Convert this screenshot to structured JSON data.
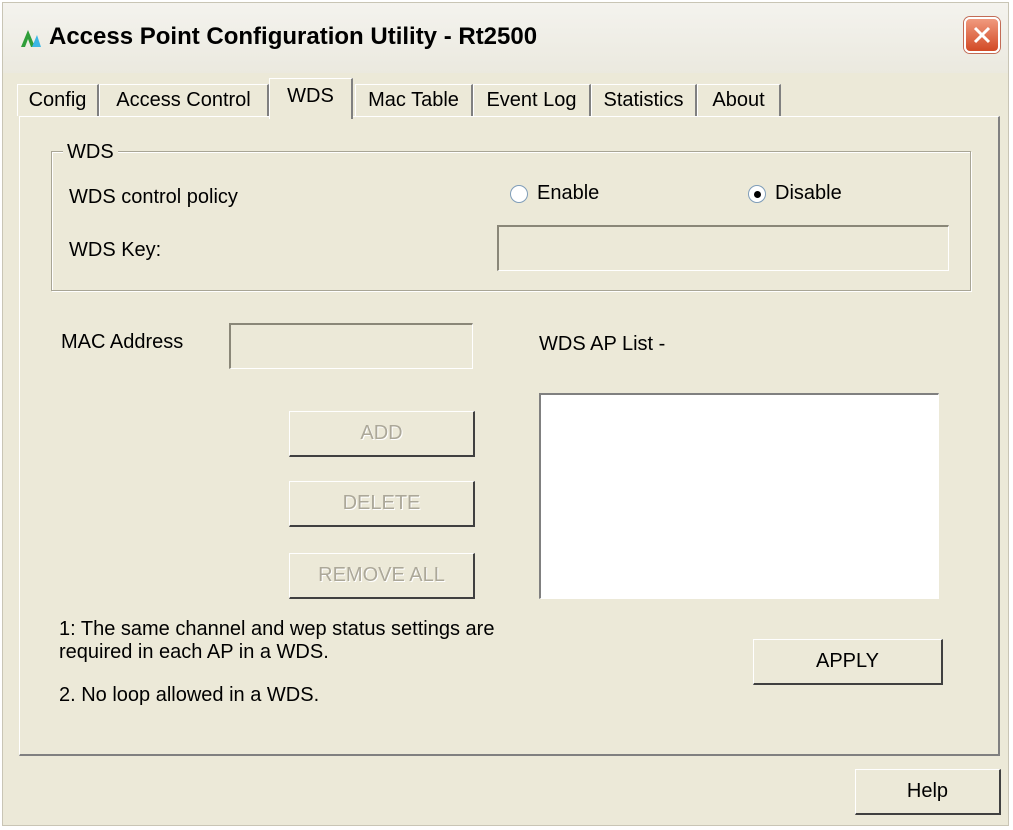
{
  "window": {
    "title": "Access Point Configuration Utility - Rt2500",
    "icon": "ap-logo-icon",
    "close_icon": "close-icon"
  },
  "tabs": [
    {
      "label": "Config"
    },
    {
      "label": "Access Control"
    },
    {
      "label": "WDS",
      "active": true
    },
    {
      "label": "Mac Table"
    },
    {
      "label": "Event Log"
    },
    {
      "label": "Statistics"
    },
    {
      "label": "About"
    }
  ],
  "wds_group": {
    "title": "WDS",
    "policy_label": "WDS control policy",
    "enable_label": "Enable",
    "disable_label": "Disable",
    "selected": "Disable",
    "key_label": "WDS Key:",
    "key_value": ""
  },
  "mac": {
    "label": "MAC Address",
    "value": ""
  },
  "ap_list": {
    "label": "WDS AP List -",
    "items": []
  },
  "buttons": {
    "add": "ADD",
    "delete": "DELETE",
    "remove_all": "REMOVE ALL",
    "apply": "APPLY",
    "help": "Help"
  },
  "notes": {
    "note1_line1": "1: The same channel and wep status settings are",
    "note1_line2": "required in each AP in a WDS.",
    "note2": "2. No loop allowed in a WDS."
  },
  "colors": {
    "window_bg": "#ece9d8",
    "close_button": "#d24a26",
    "disabled_text": "#aca899"
  }
}
